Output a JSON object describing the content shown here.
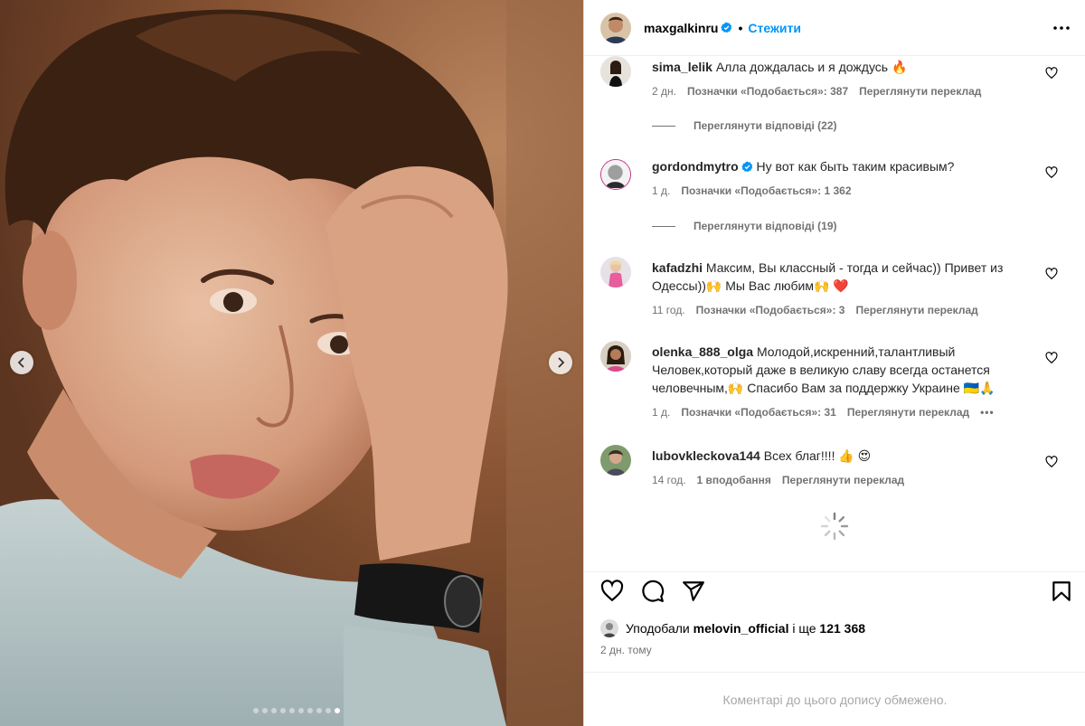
{
  "post": {
    "username": "maxgalkinru",
    "follow_label": "Стежити",
    "separator": "•"
  },
  "comments": [
    {
      "username": "sima_lelik",
      "verified": false,
      "text": "Алла дождалась и я дождусь 🔥",
      "time": "2 дн.",
      "likes": "Позначки «Подобається»: 387",
      "translate": "Переглянути переклад",
      "replies": "Переглянути відповіді (22)"
    },
    {
      "username": "gordondmytro",
      "verified": true,
      "text": "Ну вот как быть таким красивым?",
      "time": "1 д.",
      "likes": "Позначки «Подобається»: 1 362",
      "translate": "",
      "replies": "Переглянути відповіді (19)"
    },
    {
      "username": "kafadzhi",
      "verified": false,
      "text": "Максим, Вы классный - тогда и сейчас)) Привет из Одессы))🙌 Мы Вас любим🙌 ❤️",
      "time": "11 год.",
      "likes": "Позначки «Подобається»: 3",
      "translate": "Переглянути переклад",
      "replies": ""
    },
    {
      "username": "olenka_888_olga",
      "verified": false,
      "text": "Молодой,искренний,талантливый Человек,который даже в великую славу всегда останется человечным,🙌 Спасибо Вам за поддержку Украине 🇺🇦🙏",
      "time": "1 д.",
      "likes": "Позначки «Подобається»: 31",
      "translate": "Переглянути переклад",
      "replies": "",
      "more": "•••"
    },
    {
      "username": "lubovkleckova144",
      "verified": false,
      "text": "Всех благ!!!! 👍 😍",
      "time": "14 год.",
      "likes": "1 вподобання",
      "translate": "Переглянути переклад",
      "replies": ""
    }
  ],
  "likes_line": {
    "prefix": "Уподобали",
    "user": "melovin_official",
    "middle": "і ще",
    "count": "121 368"
  },
  "post_time": "2 дн. тому",
  "comments_limited": "Коментарі до цього допису обмежено.",
  "carousel": {
    "total": 10,
    "active": 9
  },
  "colors": {
    "accent": "#0095f6",
    "muted": "#737373"
  }
}
